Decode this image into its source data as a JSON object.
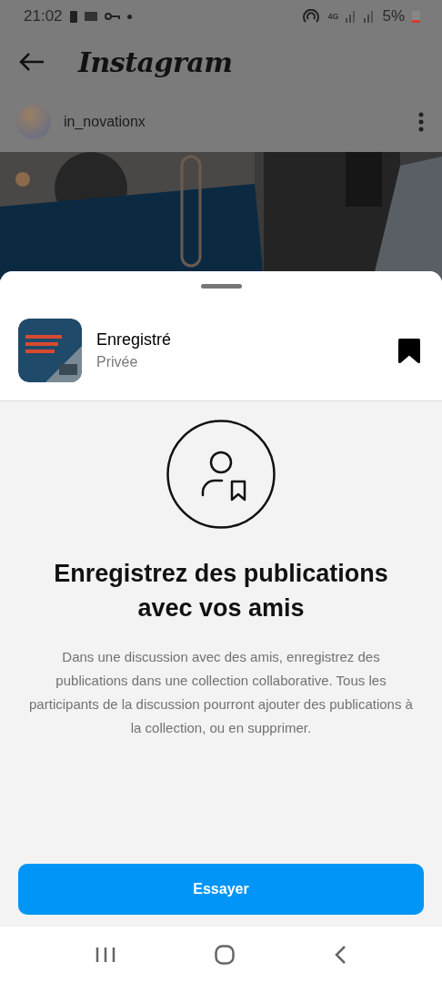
{
  "status_bar": {
    "time": "21:02",
    "network": "4G",
    "battery": "5%"
  },
  "header": {
    "title": "Instagram"
  },
  "post": {
    "username": "in_novationx"
  },
  "sheet": {
    "collection": {
      "name": "Enregistré",
      "privacy": "Privée",
      "saved": true
    },
    "headline": "Enregistrez des publications avec vos amis",
    "body": "Dans une discussion avec des amis, enregistrez des publications dans une collection collaborative. Tous les participants de la discussion pourront ajouter des publications à la collection, ou en supprimer.",
    "button": "Essayer"
  }
}
